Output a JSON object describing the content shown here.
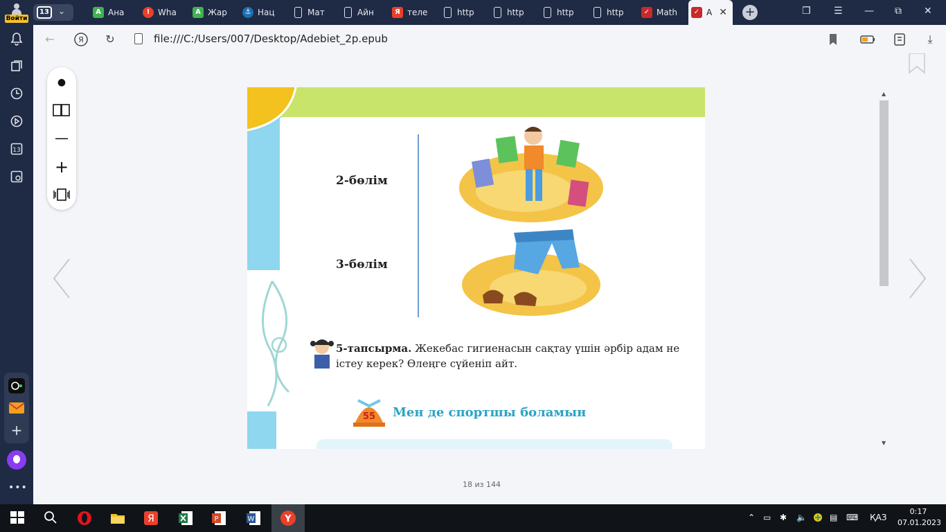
{
  "login": {
    "label": "Войти"
  },
  "tabs": {
    "count": "13",
    "items": [
      {
        "title": "Ана",
        "icon": "А",
        "color": "#3fb34f"
      },
      {
        "title": "Wha",
        "icon": "!",
        "color": "#e8412b"
      },
      {
        "title": "Жар",
        "icon": "А",
        "color": "#3fb34f"
      },
      {
        "title": "Нац",
        "icon": "⚓",
        "color": "#1a6fb3"
      },
      {
        "title": "Мат",
        "icon": "",
        "color": ""
      },
      {
        "title": "Айн",
        "icon": "",
        "color": ""
      },
      {
        "title": "теле",
        "icon": "Я",
        "color": "#e8412b"
      },
      {
        "title": "http",
        "icon": "",
        "color": ""
      },
      {
        "title": "http",
        "icon": "",
        "color": ""
      },
      {
        "title": "http",
        "icon": "",
        "color": ""
      },
      {
        "title": "http",
        "icon": "",
        "color": ""
      },
      {
        "title": "Math",
        "icon": "",
        "color": "#c82a2a"
      }
    ],
    "active": {
      "title": "A",
      "close": "✕"
    }
  },
  "address": {
    "url": "file:///C:/Users/007/Desktop/Adebiet_2p.epub"
  },
  "book": {
    "part2": "2-бөлім",
    "part3": "3-бөлім",
    "task_label": "5-тапсырма.",
    "task_text": " Жекебас гигиенасын сақтау үшін әрбір адам не істеу керек? Өлеңге сүйеніп айт.",
    "section_number": "55",
    "section_title": "Мен де спортшы боламын"
  },
  "pager": {
    "text": "18 из 144"
  },
  "taskbar": {
    "language": "ҚАЗ",
    "time": "0:17",
    "date": "07.01.2023"
  }
}
